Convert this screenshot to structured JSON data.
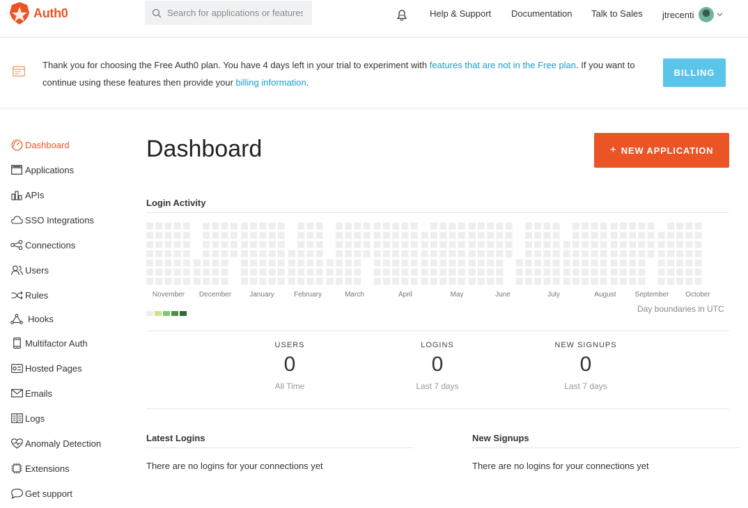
{
  "header": {
    "brand": "Auth0",
    "search_placeholder": "Search for applications or features",
    "links": [
      "Help & Support",
      "Documentation",
      "Talk to Sales"
    ],
    "user_name": "jtrecenti"
  },
  "banner": {
    "text_1": "Thank you for choosing the Free Auth0 plan. You have 4 days left in your trial to experiment with ",
    "link_1": "features that are not in the Free plan",
    "text_2": ". If you want to continue using these features then provide your ",
    "link_2": "billing information",
    "text_3": ".",
    "button": "BILLING"
  },
  "sidebar": {
    "items": [
      {
        "label": "Dashboard",
        "icon": "gauge-icon",
        "active": true
      },
      {
        "label": "Applications",
        "icon": "window-icon"
      },
      {
        "label": "APIs",
        "icon": "api-icon"
      },
      {
        "label": "SSO Integrations",
        "icon": "cloud-icon"
      },
      {
        "label": "Connections",
        "icon": "connections-icon"
      },
      {
        "label": "Users",
        "icon": "users-icon"
      },
      {
        "label": "Rules",
        "icon": "shuffle-icon"
      },
      {
        "label": "Hooks",
        "icon": "hooks-icon"
      },
      {
        "label": "Multifactor Auth",
        "icon": "phone-icon"
      },
      {
        "label": "Hosted Pages",
        "icon": "hosted-pages-icon"
      },
      {
        "label": "Emails",
        "icon": "envelope-icon"
      },
      {
        "label": "Logs",
        "icon": "book-icon"
      },
      {
        "label": "Anomaly Detection",
        "icon": "heart-pulse-icon"
      },
      {
        "label": "Extensions",
        "icon": "chip-icon"
      },
      {
        "label": "Get support",
        "icon": "chat-icon"
      }
    ]
  },
  "main": {
    "title": "Dashboard",
    "new_app_button": "NEW APPLICATION",
    "login_activity_title": "Login Activity",
    "months": [
      "November",
      "December",
      "January",
      "February",
      "March",
      "April",
      "May",
      "June",
      "July",
      "August",
      "September",
      "October"
    ],
    "utc_note": "Day boundaries in UTC",
    "legend_colors": [
      "#eeeeee",
      "#c6e48b",
      "#7bc96f",
      "#4c8f45",
      "#2e6b30"
    ],
    "empty_cell_color": "#eeeeee",
    "stats": [
      {
        "label": "USERS",
        "value": "0",
        "sub": "All Time"
      },
      {
        "label": "LOGINS",
        "value": "0",
        "sub": "Last 7 days"
      },
      {
        "label": "NEW SIGNUPS",
        "value": "0",
        "sub": "Last 7 days"
      }
    ],
    "latest_logins_title": "Latest Logins",
    "latest_logins_empty": "There are no logins for your connections yet",
    "new_signups_title": "New Signups",
    "new_signups_empty": "There are no logins for your connections yet"
  },
  "colors": {
    "accent": "#eb5424",
    "billing_button": "#5bc4ea",
    "link": "#16a0cb"
  }
}
